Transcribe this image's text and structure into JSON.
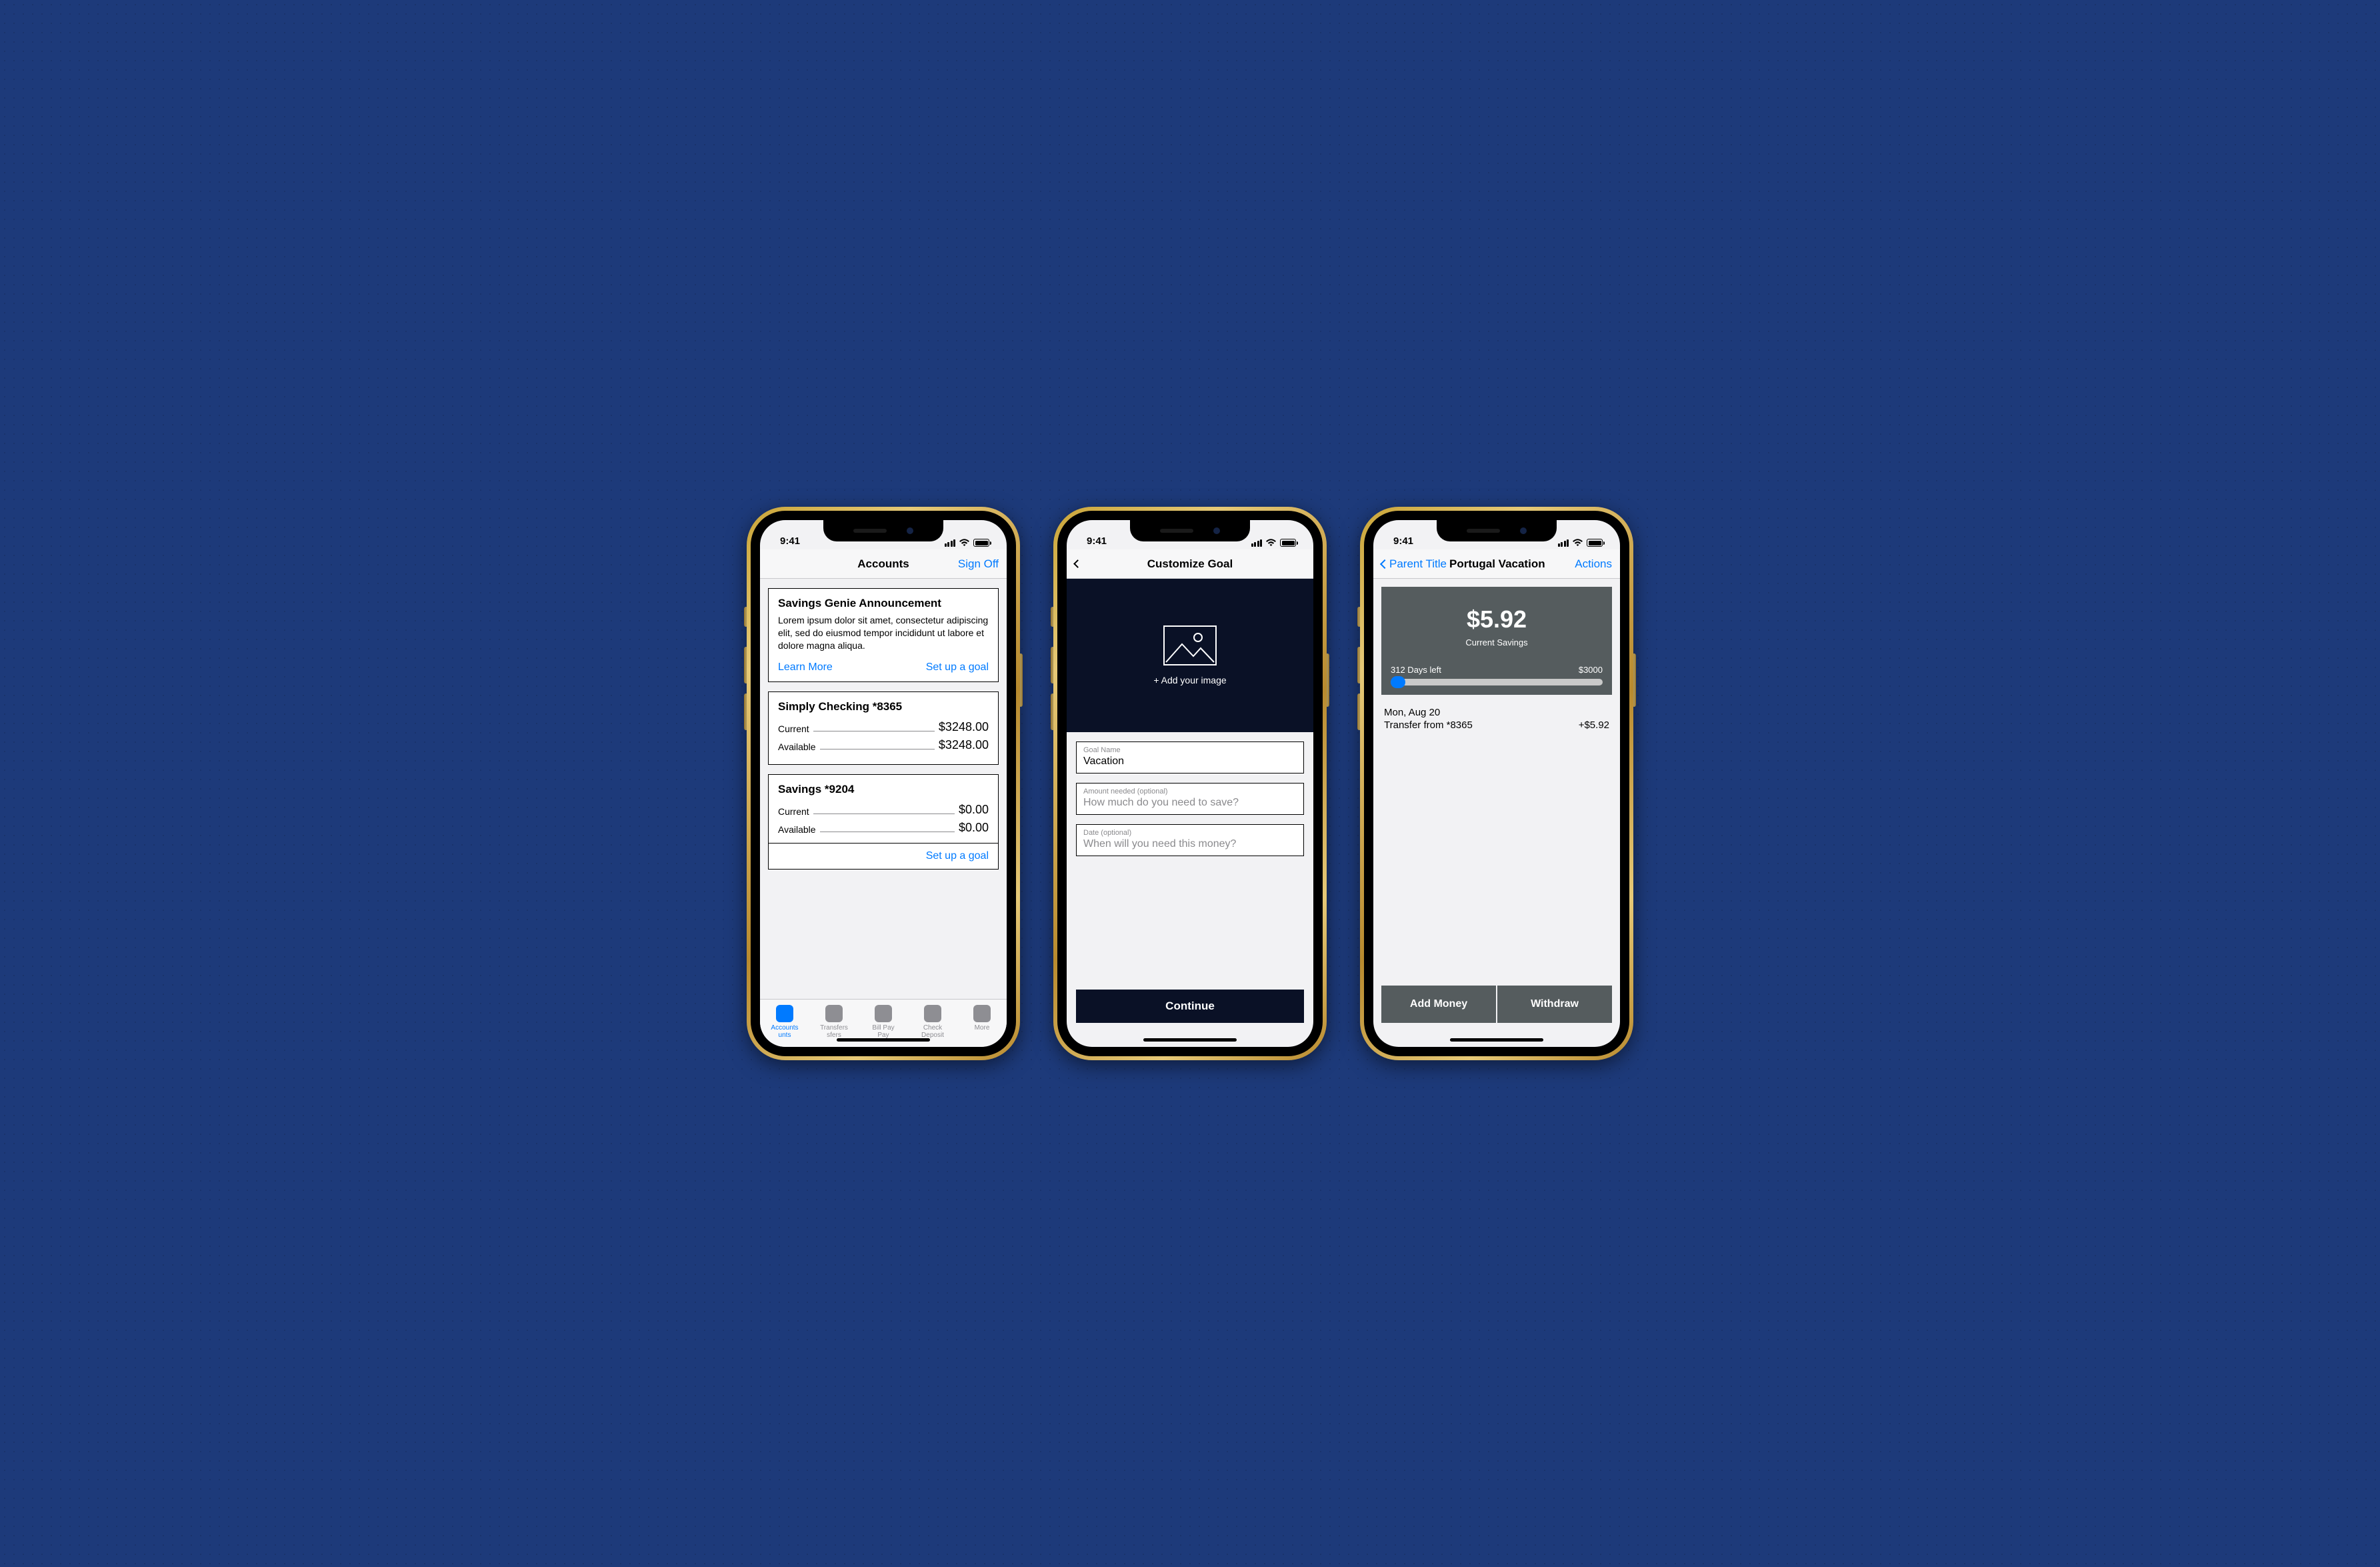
{
  "status": {
    "time": "9:41"
  },
  "phone1": {
    "nav": {
      "title": "Accounts",
      "signoff": "Sign Off"
    },
    "announcement": {
      "title": "Savings Genie Announcement",
      "body": "Lorem ipsum dolor sit amet, consectetur adipiscing elit, sed do eiusmod tempor incididunt ut labore et dolore magna aliqua.",
      "learn_more": "Learn More",
      "set_up": "Set up a goal"
    },
    "accounts": [
      {
        "name": "Simply Checking *8365",
        "current_label": "Current",
        "current_value": "$3248.00",
        "available_label": "Available",
        "available_value": "$3248.00"
      },
      {
        "name": "Savings *9204",
        "current_label": "Current",
        "current_value": "$0.00",
        "available_label": "Available",
        "available_value": "$0.00",
        "footer": "Set up a goal"
      }
    ],
    "tabs": [
      {
        "line1": "Accounts",
        "line2": "unts"
      },
      {
        "line1": "Transfers",
        "line2": "sfers"
      },
      {
        "line1": "Bill Pay",
        "line2": "Pay"
      },
      {
        "line1": "Check",
        "line2": "Deposit"
      },
      {
        "line1": "More",
        "line2": ""
      }
    ]
  },
  "phone2": {
    "nav": {
      "title": "Customize Goal"
    },
    "hero_add": "+ Add your image",
    "fields": [
      {
        "label": "Goal Name",
        "value": "Vacation",
        "is_placeholder": false
      },
      {
        "label": "Amount needed (optional)",
        "value": "How much do you need to save?",
        "is_placeholder": true
      },
      {
        "label": "Date (optional)",
        "value": "When will you need this money?",
        "is_placeholder": true
      }
    ],
    "continue": "Continue"
  },
  "phone3": {
    "nav": {
      "parent": "Parent Title",
      "title": "Portugal Vacation",
      "actions": "Actions"
    },
    "goal": {
      "amount": "$5.92",
      "subtitle": "Current Savings",
      "days_left": "312 Days left",
      "target": "$3000"
    },
    "txn": {
      "date": "Mon, Aug 20",
      "desc": "Transfer from *8365",
      "amount": "+$5.92"
    },
    "actions": {
      "add": "Add Money",
      "withdraw": "Withdraw"
    }
  }
}
